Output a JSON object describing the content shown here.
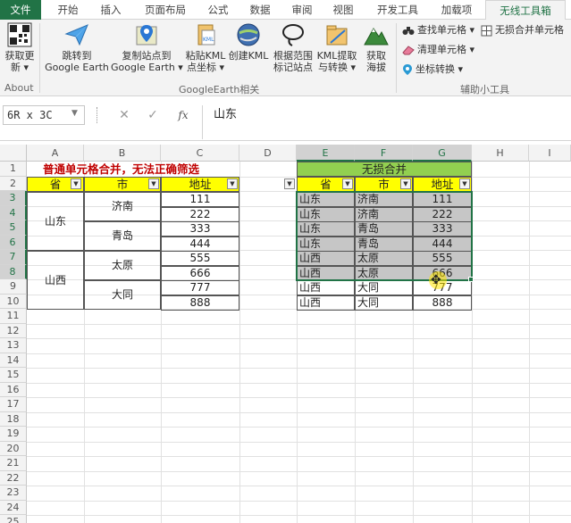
{
  "ribbon_tabs": [
    "文件",
    "开始",
    "插入",
    "页面布局",
    "公式",
    "数据",
    "审阅",
    "视图",
    "开发工具",
    "加载项",
    "无线工具箱"
  ],
  "ribbon": {
    "get_update": [
      "获取更",
      "新 ▾"
    ],
    "jump_ge": [
      "跳转到",
      "Google Earth"
    ],
    "copy_site": [
      "复制站点到",
      "Google Earth ▾"
    ],
    "paste_kml": [
      "粘贴KML",
      "点坐标 ▾"
    ],
    "create_kml": [
      "创建KML",
      ""
    ],
    "mark_range": [
      "根据范围",
      "标记站点"
    ],
    "extract_kml": [
      "KML提取",
      "与转换 ▾"
    ],
    "get_alt": [
      "获取",
      "海拔"
    ],
    "find_cell": "查找单元格 ▾",
    "clean_cell": "清理单元格 ▾",
    "coord_convert": "坐标转换 ▾",
    "lossless_merge": "无损合并单元格",
    "group_about": "About",
    "group_ge": "GoogleEarth相关",
    "group_aux": "辅助小工具"
  },
  "formula_bar": {
    "name_box": "6R x 3C",
    "cancel": "✕",
    "enter": "✓",
    "fx": "fx",
    "content": "山东"
  },
  "columns": [
    "A",
    "B",
    "C",
    "D",
    "E",
    "F",
    "G",
    "H",
    "I"
  ],
  "rows": [
    "1",
    "2",
    "3",
    "4",
    "5",
    "6",
    "7",
    "8",
    "9",
    "10",
    "11",
    "12",
    "13",
    "14",
    "15",
    "16",
    "17",
    "18",
    "19",
    "20",
    "21",
    "22",
    "23",
    "24",
    "25"
  ],
  "left_table": {
    "title": "普通单元格合并，无法正确筛选",
    "headers": [
      "省",
      "市",
      "地址"
    ],
    "provinces": [
      "山东",
      "山西"
    ],
    "cities": [
      "济南",
      "青岛",
      "太原",
      "大同"
    ],
    "addresses": [
      "111",
      "222",
      "333",
      "444",
      "555",
      "666",
      "777",
      "888"
    ]
  },
  "right_table": {
    "title": "无损合并",
    "headers": [
      "省",
      "市",
      "地址"
    ],
    "rows": [
      [
        "山东",
        "济南",
        "111"
      ],
      [
        "山东",
        "济南",
        "222"
      ],
      [
        "山东",
        "青岛",
        "333"
      ],
      [
        "山东",
        "青岛",
        "444"
      ],
      [
        "山西",
        "太原",
        "555"
      ],
      [
        "山西",
        "太原",
        "666"
      ],
      [
        "山西",
        "大同",
        "777"
      ],
      [
        "山西",
        "大同",
        "888"
      ]
    ]
  },
  "colors": {
    "excel_green": "#217346",
    "header_yellow": "#ffff00",
    "header_green": "#92d050",
    "title_red": "#c00000"
  }
}
